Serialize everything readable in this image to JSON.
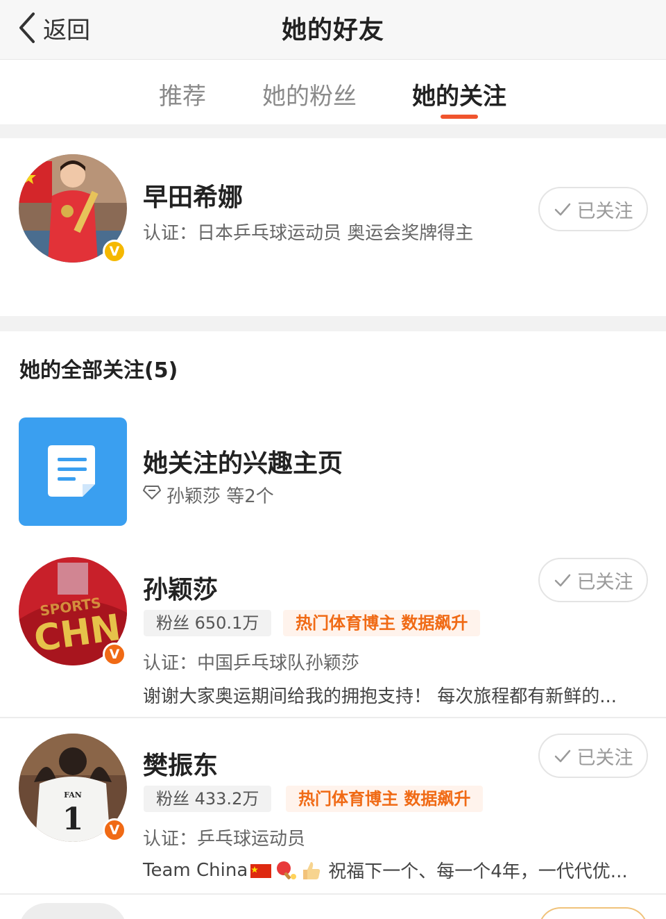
{
  "header": {
    "back_label": "返回",
    "title": "她的好友"
  },
  "tabs": [
    {
      "label": "推荐",
      "active": false
    },
    {
      "label": "她的粉丝",
      "active": false
    },
    {
      "label": "她的关注",
      "active": true
    }
  ],
  "accent_color": "#f0542d",
  "featured": {
    "name": "早田希娜",
    "cert": "认证：日本乒乓球运动员 奥运会奖牌得主",
    "follow_label": "已关注",
    "badge": "V"
  },
  "section_title": "她的全部关注(5)",
  "interest": {
    "title": "她关注的兴趣主页",
    "subtitle": "孙颖莎 等2个"
  },
  "users": [
    {
      "name": "孙颖莎",
      "fans": "粉丝 650.1万",
      "tag": "热门体育博主 数据飙升",
      "cert": "认证：中国乒乓球队孙颖莎",
      "desc": "谢谢大家奥运期间给我的拥抱支持！ 每次旅程都有新鲜的...",
      "follow_label": "已关注",
      "badge": "V"
    },
    {
      "name": "樊振东",
      "fans": "粉丝 433.2万",
      "tag": "热门体育博主 数据飙升",
      "cert": "认证：乒乓球运动员",
      "desc_prefix": "Team China",
      "desc": "祝福下一个、每一个4年，一代代优...",
      "follow_label": "已关注",
      "badge": "V",
      "jersey_text": "FAN",
      "jersey_number": "1"
    }
  ]
}
